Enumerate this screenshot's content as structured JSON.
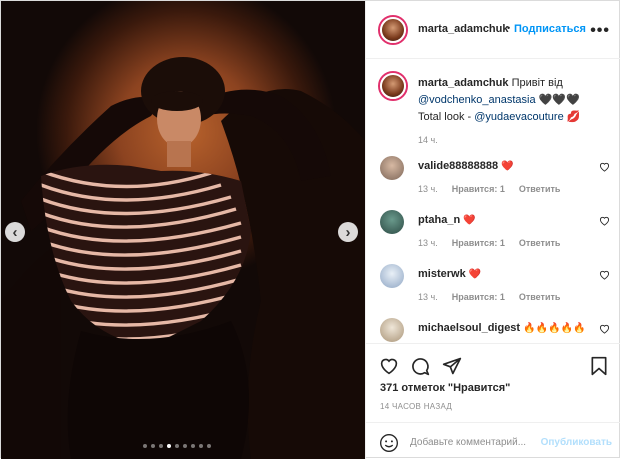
{
  "post": {
    "dots_count": 9,
    "active_dot": 3
  },
  "header": {
    "username": "marta_adamchuk",
    "separator": "•",
    "follow_label": "Подписаться",
    "more_label": "•••"
  },
  "caption": {
    "username": "marta_adamchuk",
    "text": "Привіт від",
    "mention": "@vodchenko_anastasia",
    "hearts": "🖤🖤🖤",
    "line2_prefix": "Total look - ",
    "mention2": "@yudaevacouture",
    "lips": "💋",
    "time": "14 ч."
  },
  "comments": [
    {
      "username": "valide88888888",
      "text": "❤️",
      "time": "13 ч.",
      "likes": "Нравится: 1",
      "reply": "Ответить"
    },
    {
      "username": "ptaha_n",
      "text": "❤️",
      "time": "13 ч.",
      "likes": "Нравится: 1",
      "reply": "Ответить"
    },
    {
      "username": "misterwk",
      "text": "❤️",
      "time": "13 ч.",
      "likes": "Нравится: 1",
      "reply": "Ответить"
    },
    {
      "username": "michaelsoul_digest",
      "text": "🔥🔥🔥🔥🔥",
      "time": "",
      "likes": "",
      "reply": ""
    }
  ],
  "actions": {
    "likes_text": "371 отметок \"Нравится\"",
    "time_ago": "14 ЧАСОВ НАЗАД"
  },
  "add_comment": {
    "placeholder": "Добавьте комментарий...",
    "publish_label": "Опубликовать"
  },
  "colors": {
    "accent": "#0095f6",
    "heart": "#ed4956"
  }
}
